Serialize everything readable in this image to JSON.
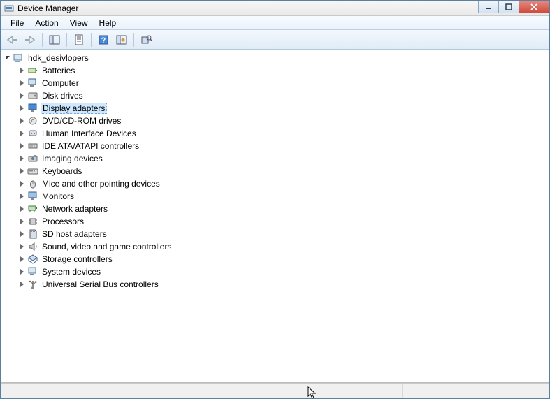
{
  "window": {
    "title": "Device Manager"
  },
  "menu": {
    "file": "File",
    "action": "Action",
    "view": "View",
    "help": "Help"
  },
  "tree": {
    "root": "hdk_desivlopers",
    "nodes": [
      {
        "label": "Batteries",
        "icon": "battery"
      },
      {
        "label": "Computer",
        "icon": "computer"
      },
      {
        "label": "Disk drives",
        "icon": "disk"
      },
      {
        "label": "Display adapters",
        "icon": "display",
        "selected": true
      },
      {
        "label": "DVD/CD-ROM drives",
        "icon": "dvd"
      },
      {
        "label": "Human Interface Devices",
        "icon": "hid"
      },
      {
        "label": "IDE ATA/ATAPI controllers",
        "icon": "ide"
      },
      {
        "label": "Imaging devices",
        "icon": "imaging"
      },
      {
        "label": "Keyboards",
        "icon": "keyboard"
      },
      {
        "label": "Mice and other pointing devices",
        "icon": "mouse"
      },
      {
        "label": "Monitors",
        "icon": "monitor"
      },
      {
        "label": "Network adapters",
        "icon": "network"
      },
      {
        "label": "Processors",
        "icon": "cpu"
      },
      {
        "label": "SD host adapters",
        "icon": "sd"
      },
      {
        "label": "Sound, video and game controllers",
        "icon": "sound"
      },
      {
        "label": "Storage controllers",
        "icon": "storage"
      },
      {
        "label": "System devices",
        "icon": "system"
      },
      {
        "label": "Universal Serial Bus controllers",
        "icon": "usb"
      }
    ]
  }
}
